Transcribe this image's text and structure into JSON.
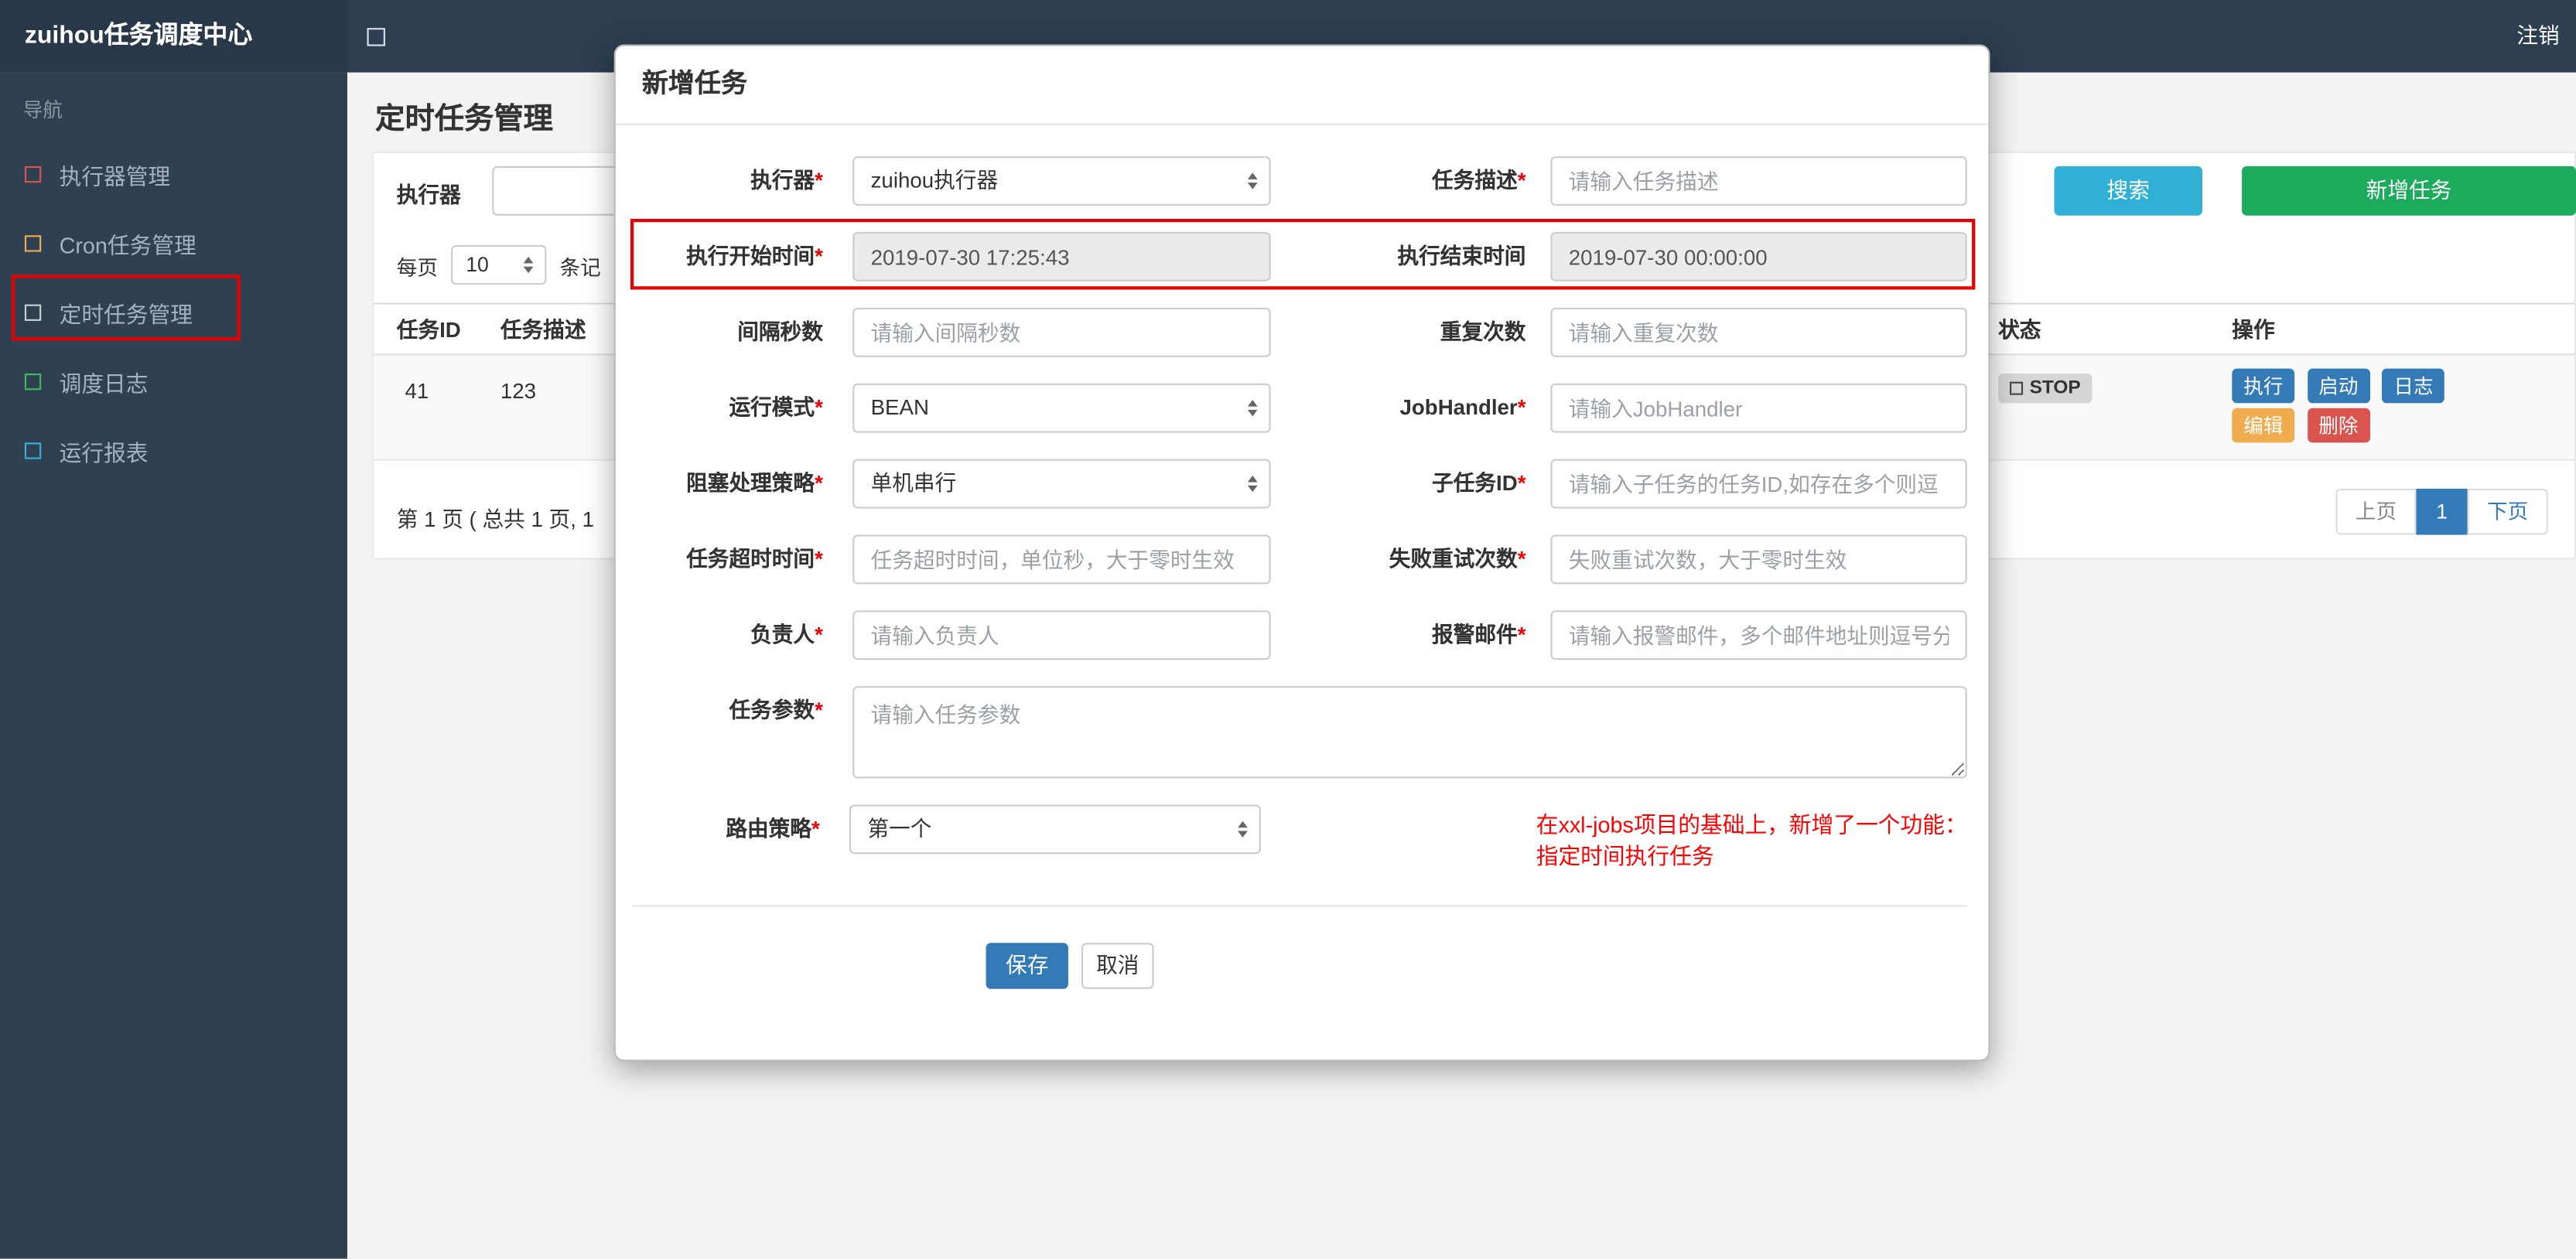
{
  "colors": {
    "topbar_bg": "#2c3e50",
    "sidebar_bg": "#2f4050",
    "accent_blue": "#337ab7",
    "search_button": "#31b0d5",
    "add_button": "#1cab5c",
    "edit_button": "#f0ad4e",
    "delete_button": "#d9534f",
    "annotation_red": "#e60000",
    "note_red": "#ff0000"
  },
  "topbar": {
    "brand": "zuihou任务调度中心",
    "logout": "注销"
  },
  "sidebar": {
    "section_label": "导航",
    "items": [
      {
        "label": "执行器管理",
        "icon_style": "border-color:#d9534f"
      },
      {
        "label": "Cron任务管理",
        "icon_style": "border-color:#f0ad4e"
      },
      {
        "label": "定时任务管理",
        "icon_style": "border-color:#c8d0d8"
      },
      {
        "label": "调度日志",
        "icon_style": "border-color:#3dbd5d"
      },
      {
        "label": "运行报表",
        "icon_style": "border-color:#3bafda"
      }
    ]
  },
  "page": {
    "title": "定时任务管理",
    "filter": {
      "executor_label": "执行器",
      "search_button": "搜索",
      "add_button": "新增任务"
    },
    "per_page": {
      "prefix": "每页",
      "value": "10",
      "suffix": "条记"
    },
    "table": {
      "headers": {
        "id": "任务ID",
        "desc": "任务描述",
        "status": "状态",
        "actions": "操作"
      },
      "row": {
        "id": "41",
        "desc": "123",
        "status": "STOP",
        "actions": {
          "run": "执行",
          "start": "启动",
          "log": "日志",
          "edit": "编辑",
          "delete": "删除"
        }
      }
    },
    "pagination": {
      "summary": "第 1 页 ( 总共 1 页, 1",
      "prev": "上页",
      "current": "1",
      "next": "下页"
    }
  },
  "modal": {
    "title": "新增任务",
    "fields": {
      "executor": {
        "label": "执行器",
        "required": "*",
        "value": "zuihou执行器"
      },
      "job_desc": {
        "label": "任务描述",
        "required": "*",
        "placeholder": "请输入任务描述"
      },
      "start_time": {
        "label": "执行开始时间",
        "required": "*",
        "value": "2019-07-30 17:25:43"
      },
      "end_time": {
        "label": "执行结束时间",
        "value": "2019-07-30 00:00:00"
      },
      "interval": {
        "label": "间隔秒数",
        "placeholder": "请输入间隔秒数"
      },
      "repeat": {
        "label": "重复次数",
        "placeholder": "请输入重复次数"
      },
      "run_mode": {
        "label": "运行模式",
        "required": "*",
        "value": "BEAN"
      },
      "job_handler": {
        "label": "JobHandler",
        "required": "*",
        "placeholder": "请输入JobHandler"
      },
      "block_strategy": {
        "label": "阻塞处理策略",
        "required": "*",
        "value": "单机串行"
      },
      "child_job_id": {
        "label": "子任务ID",
        "required": "*",
        "placeholder": "请输入子任务的任务ID,如存在多个则逗"
      },
      "timeout": {
        "label": "任务超时时间",
        "required": "*",
        "placeholder": "任务超时时间，单位秒，大于零时生效"
      },
      "fail_retry": {
        "label": "失败重试次数",
        "required": "*",
        "placeholder": "失败重试次数，大于零时生效"
      },
      "owner": {
        "label": "负责人",
        "required": "*",
        "placeholder": "请输入负责人"
      },
      "alarm_email": {
        "label": "报警邮件",
        "required": "*",
        "placeholder": "请输入报警邮件，多个邮件地址则逗号分"
      },
      "job_params": {
        "label": "任务参数",
        "required": "*",
        "placeholder": "请输入任务参数"
      },
      "route_strategy": {
        "label": "路由策略",
        "required": "*",
        "value": "第一个"
      }
    },
    "note": {
      "line1": "在xxl-jobs项目的基础上，新增了一个功能：",
      "line2": "指定时间执行任务"
    },
    "save_button": "保存",
    "cancel_button": "取消"
  }
}
